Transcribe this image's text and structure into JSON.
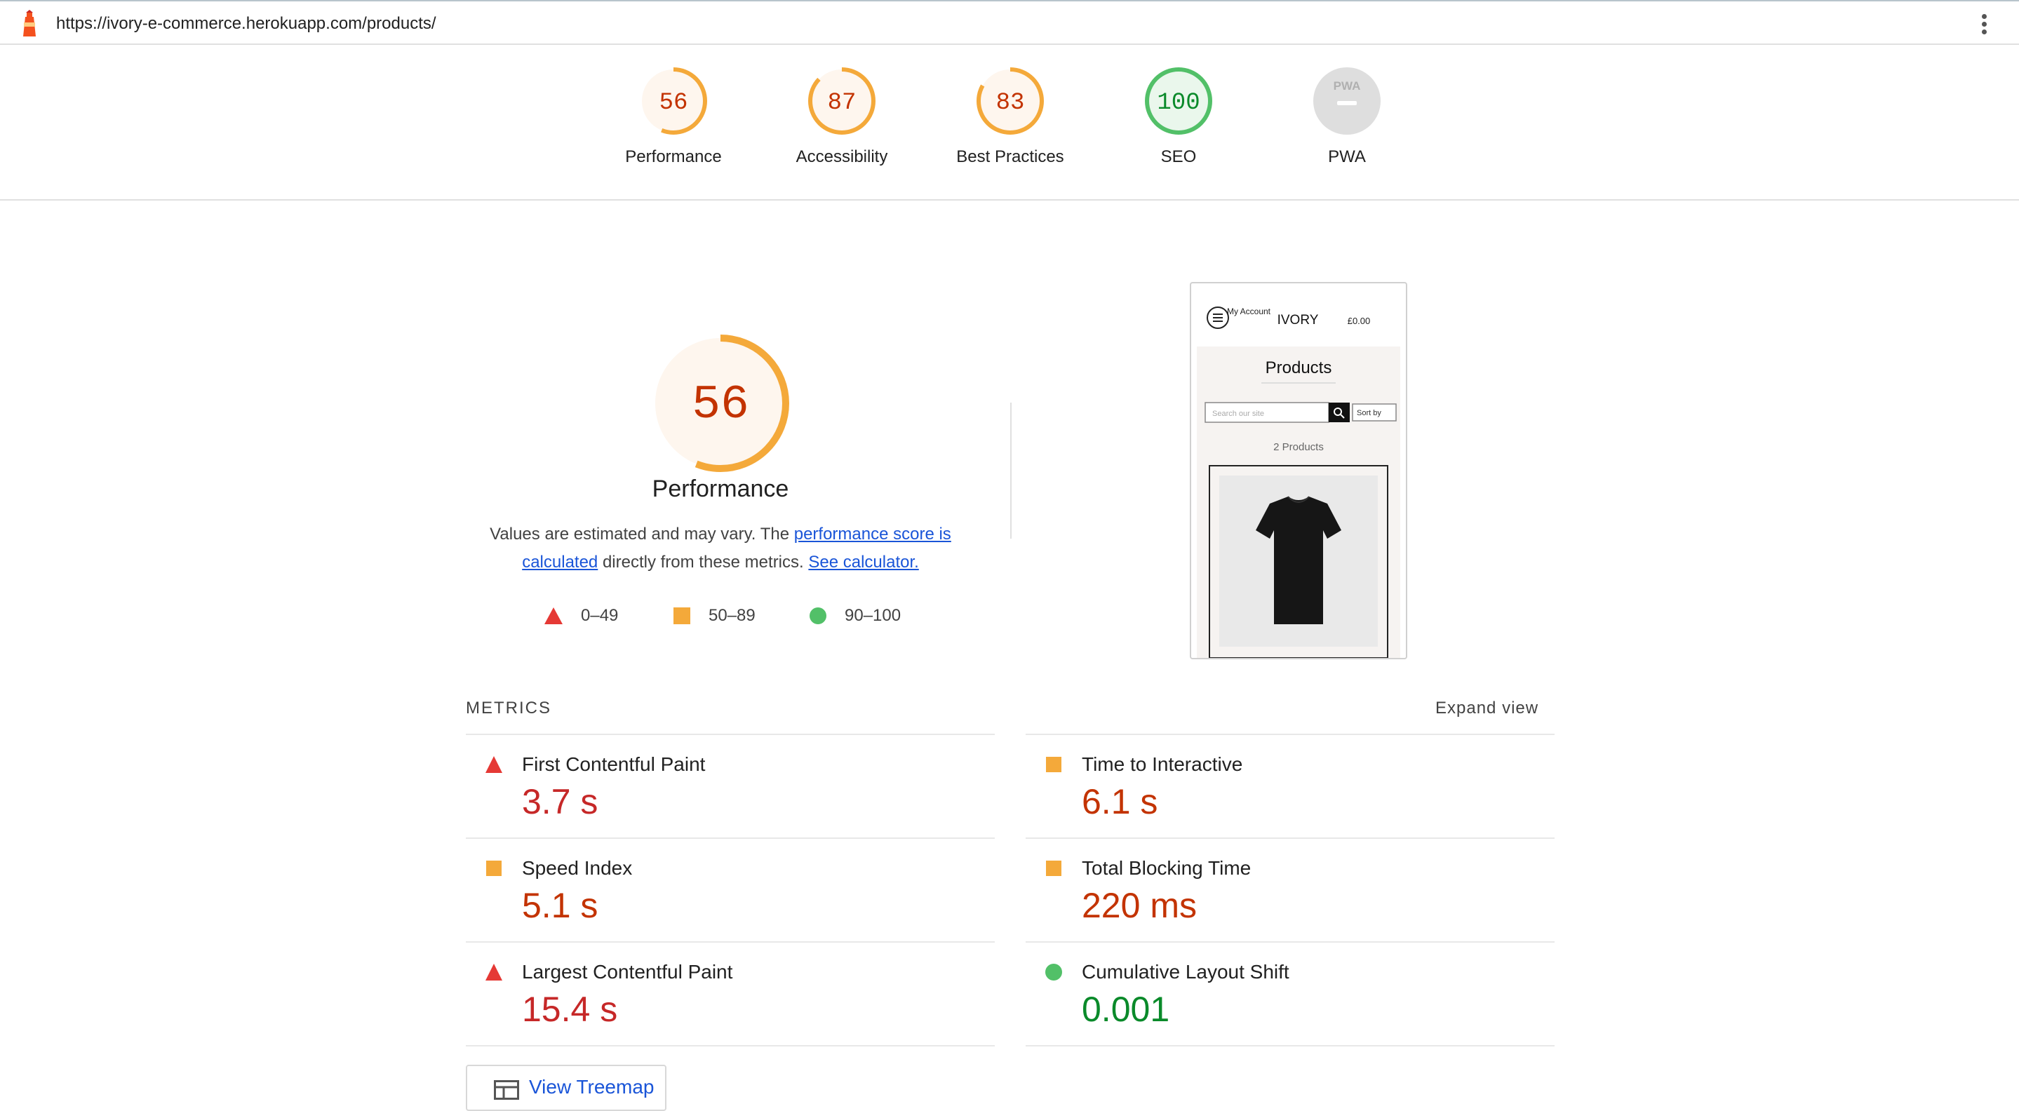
{
  "header": {
    "url": "https://ivory-e-commerce.herokuapp.com/products/"
  },
  "colors": {
    "fail": "#e53935",
    "average": "#f4a93a",
    "pass": "#52c068",
    "fail_text": "#c62828",
    "average_text": "#c33300",
    "pass_text": "#0a8a2a",
    "link": "#1a55d8"
  },
  "summary": {
    "gauges": [
      {
        "score": "56",
        "value": 56,
        "label": "Performance",
        "rating": "average"
      },
      {
        "score": "87",
        "value": 87,
        "label": "Accessibility",
        "rating": "average"
      },
      {
        "score": "83",
        "value": 83,
        "label": "Best Practices",
        "rating": "average"
      },
      {
        "score": "100",
        "value": 100,
        "label": "SEO",
        "rating": "pass"
      },
      {
        "score": "PWA",
        "value": 0,
        "label": "PWA",
        "rating": "na"
      }
    ]
  },
  "performance": {
    "score": "56",
    "value": 56,
    "title": "Performance",
    "desc_prefix": "Values are estimated and may vary. The ",
    "desc_link1": "performance score is calculated",
    "desc_middle": " directly from these metrics. ",
    "desc_link2": "See calculator.",
    "legend": [
      {
        "range": "0–49",
        "shape": "triangle",
        "rating": "fail"
      },
      {
        "range": "50–89",
        "shape": "square",
        "rating": "average"
      },
      {
        "range": "90–100",
        "shape": "circle",
        "rating": "pass"
      }
    ]
  },
  "thumbnail": {
    "my_account": "My Account",
    "brand": "IVORY",
    "cart_total": "£0.00",
    "page_heading": "Products",
    "search_placeholder": "Search our site",
    "sort_label": "Sort by",
    "product_count": "2 Products"
  },
  "metrics": {
    "heading": "METRICS",
    "expand_label": "Expand view",
    "items": [
      {
        "title": "First Contentful Paint",
        "value": "3.7 s",
        "rating": "fail"
      },
      {
        "title": "Time to Interactive",
        "value": "6.1 s",
        "rating": "average"
      },
      {
        "title": "Speed Index",
        "value": "5.1 s",
        "rating": "average"
      },
      {
        "title": "Total Blocking Time",
        "value": "220 ms",
        "rating": "average"
      },
      {
        "title": "Largest Contentful Paint",
        "value": "15.4 s",
        "rating": "fail"
      },
      {
        "title": "Cumulative Layout Shift",
        "value": "0.001",
        "rating": "pass"
      }
    ]
  },
  "treemap": {
    "label": "View Treemap"
  }
}
